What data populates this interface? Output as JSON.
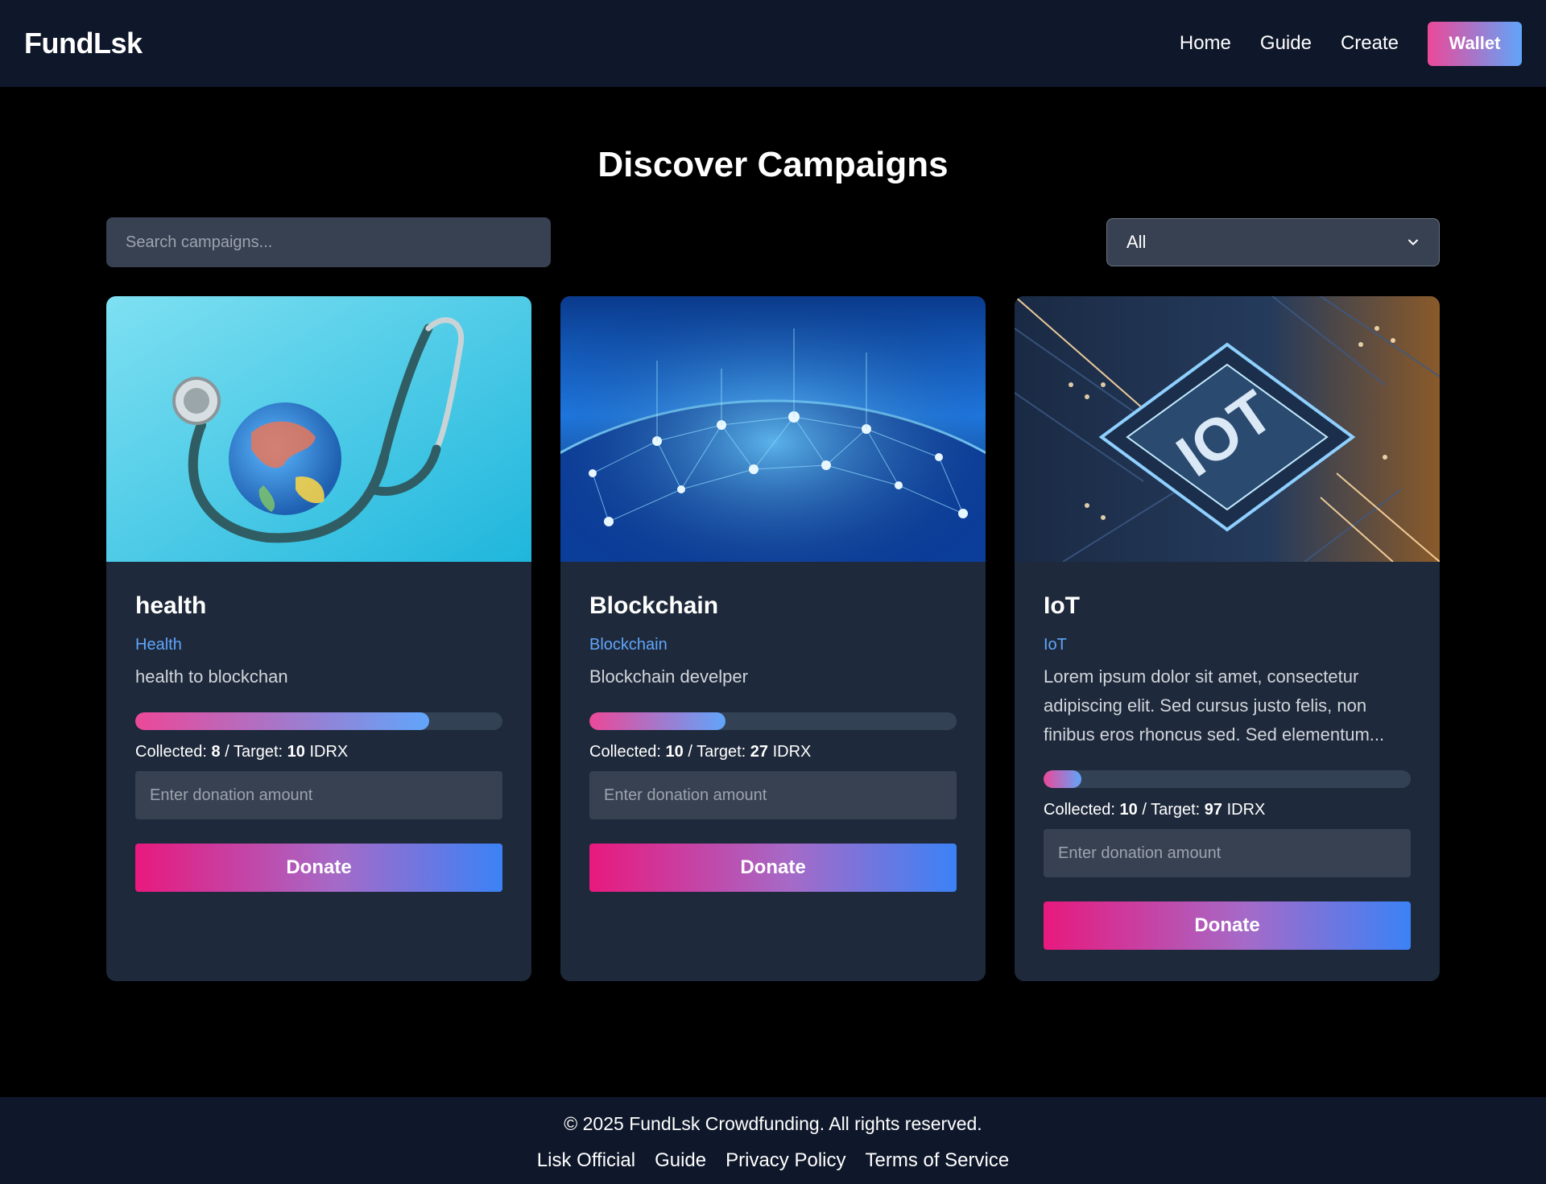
{
  "nav": {
    "brand": "FundLsk",
    "links": [
      "Home",
      "Guide",
      "Create"
    ],
    "wallet_label": "Wallet"
  },
  "main": {
    "title": "Discover Campaigns",
    "search_placeholder": "Search campaigns...",
    "filter_selected": "All"
  },
  "campaigns": [
    {
      "title": "health",
      "category": "Health",
      "description": "health to blockchan",
      "collected_label": "Collected:",
      "collected": "8",
      "target_label": "/ Target:",
      "target": "10",
      "currency": "IDRX",
      "progress": 0.8,
      "donation_placeholder": "Enter donation amount",
      "donate_label": "Donate"
    },
    {
      "title": "Blockchain",
      "category": "Blockchain",
      "description": "Blockchain develper",
      "collected_label": "Collected:",
      "collected": "10",
      "target_label": "/ Target:",
      "target": "27",
      "currency": "IDRX",
      "progress": 0.37,
      "donation_placeholder": "Enter donation amount",
      "donate_label": "Donate"
    },
    {
      "title": "IoT",
      "category": "IoT",
      "description": "Lorem ipsum dolor sit amet, consectetur adipiscing elit. Sed cursus justo felis, non finibus eros rhoncus sed. Sed elementum...",
      "collected_label": "Collected:",
      "collected": "10",
      "target_label": "/ Target:",
      "target": "97",
      "currency": "IDRX",
      "progress": 0.103,
      "donation_placeholder": "Enter donation amount",
      "donate_label": "Donate"
    }
  ],
  "footer": {
    "copyright": "© 2025 FundLsk Crowdfunding. All rights reserved.",
    "links": [
      "Lisk Official",
      "Guide",
      "Privacy Policy",
      "Terms of Service"
    ]
  },
  "colors": {
    "nav_bg": "#0f172a",
    "card_bg": "#1e293b",
    "accent_pink": "#ec4899",
    "accent_blue": "#60a5fa"
  }
}
